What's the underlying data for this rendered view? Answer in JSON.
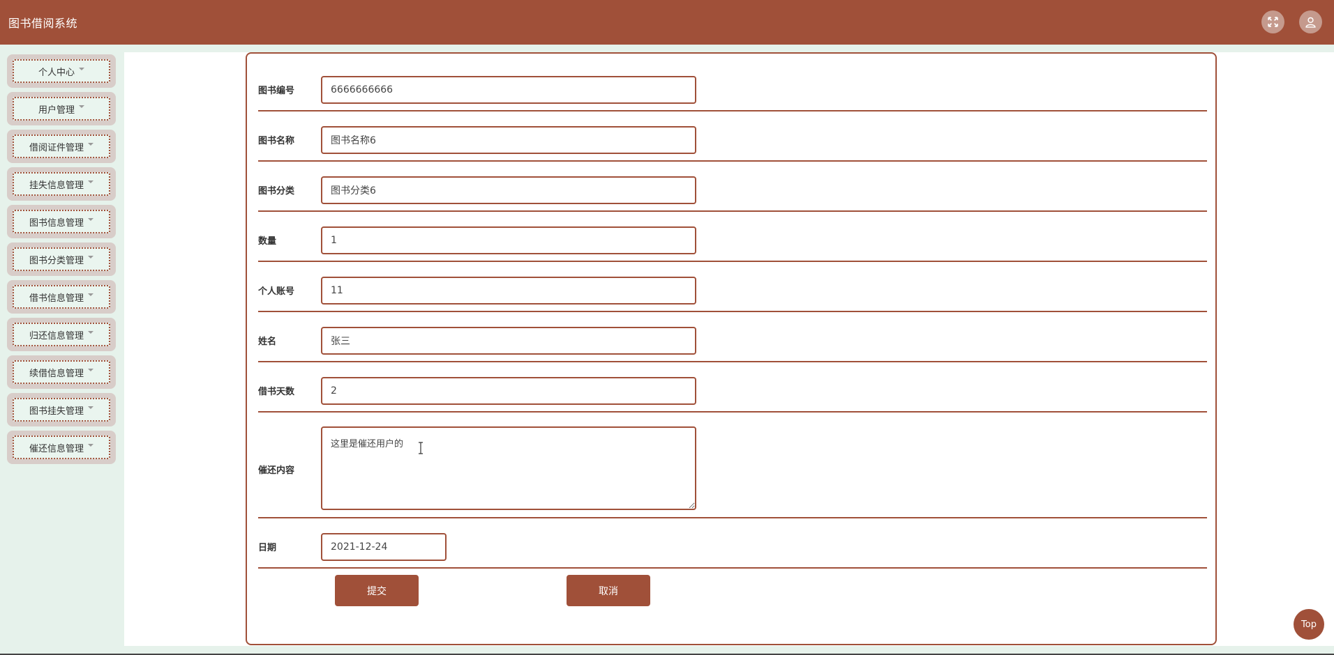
{
  "app": {
    "title": "图书借阅系统"
  },
  "header": {
    "fullscreen_icon": "fullscreen-icon",
    "user_icon": "user-icon"
  },
  "sidebar": {
    "items": [
      {
        "label": "个人中心"
      },
      {
        "label": "用户管理"
      },
      {
        "label": "借阅证件管理"
      },
      {
        "label": "挂失信息管理"
      },
      {
        "label": "图书信息管理"
      },
      {
        "label": "图书分类管理"
      },
      {
        "label": "借书信息管理"
      },
      {
        "label": "归还信息管理"
      },
      {
        "label": "续借信息管理"
      },
      {
        "label": "图书挂失管理"
      },
      {
        "label": "催还信息管理"
      }
    ]
  },
  "form": {
    "fields": [
      {
        "label": "图书编号",
        "value": "6666666666"
      },
      {
        "label": "图书名称",
        "value": "图书名称6"
      },
      {
        "label": "图书分类",
        "value": "图书分类6"
      },
      {
        "label": "数量",
        "value": "1"
      },
      {
        "label": "个人账号",
        "value": "11"
      },
      {
        "label": "姓名",
        "value": "张三"
      },
      {
        "label": "借书天数",
        "value": "2"
      }
    ],
    "content": {
      "label": "催还内容",
      "value": "这里是催还用户的"
    },
    "date": {
      "label": "日期",
      "value": "2021-12-24"
    },
    "submit_label": "提交",
    "cancel_label": "取消"
  },
  "top_button": {
    "label": "Top"
  },
  "colors": {
    "brand": "#a05039",
    "background": "#e6f2eb"
  }
}
